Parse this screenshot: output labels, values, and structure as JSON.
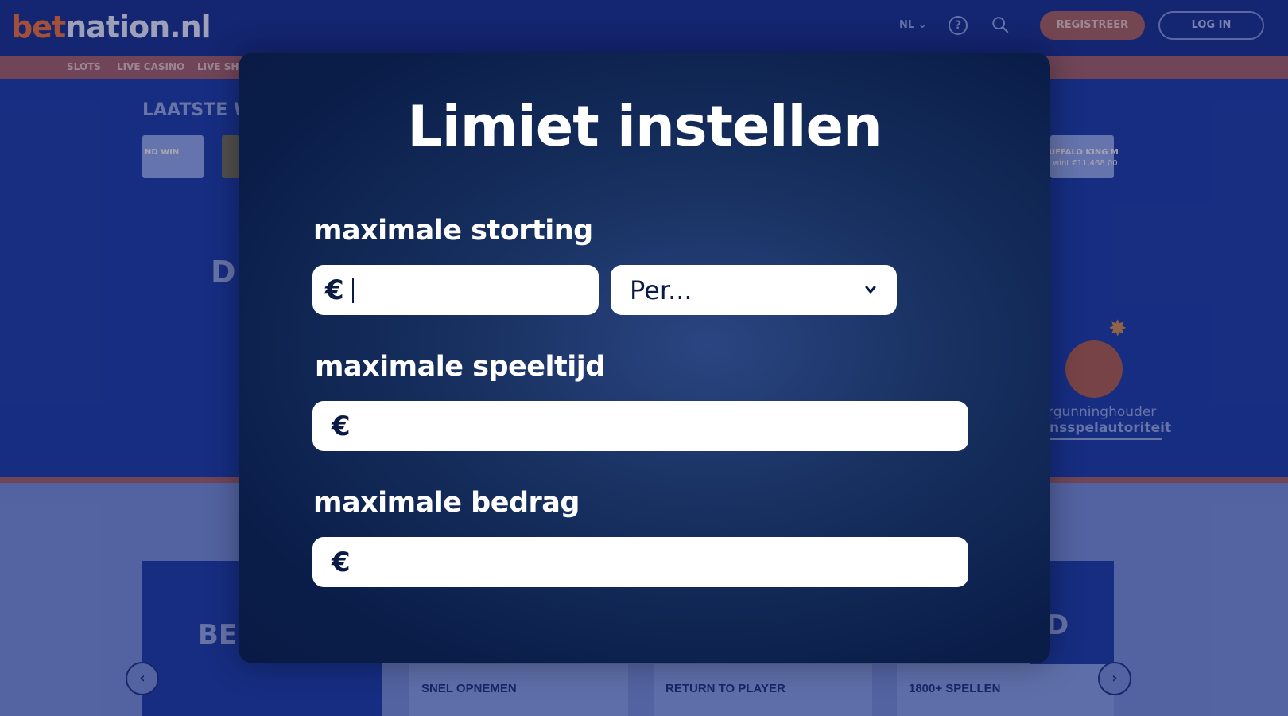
{
  "site": {
    "logo_part1": "bet",
    "logo_part2": "nation.nl",
    "language": "NL",
    "register_label": "REGISTREER",
    "login_label": "LOG IN",
    "nav": [
      "SLOTS",
      "LIVE CASINO",
      "LIVE SH"
    ],
    "latest_title": "LAATSTE W",
    "tile_left_text": "ND WIN",
    "tile_right_name": "UFFALO KING M",
    "tile_right_win": "wint €11,468.00",
    "hero_letter": "D",
    "license_line1": "rgunninghouder",
    "license_line2": "nsspelautoriteit",
    "card_big_text": "BE",
    "card_right_letter": "D",
    "info_cards": [
      "SNEL OPNEMEN",
      "RETURN TO PLAYER",
      "1800+ SPELLEN"
    ],
    "arrow_prev": "‹",
    "arrow_next": "›"
  },
  "modal": {
    "title": "Limiet instellen",
    "deposit_label": "maximale storting",
    "deposit_prefix": "€",
    "deposit_value": "",
    "period_select": "Per...",
    "playtime_label": "maximale speeltijd",
    "playtime_prefix": "€",
    "amount_label": "maximale bedrag",
    "amount_prefix": "€"
  },
  "colors": {
    "brand_orange": "#e06a3a",
    "modal_dark": "#0a1a45",
    "page_blue": "#1e3a9c"
  }
}
